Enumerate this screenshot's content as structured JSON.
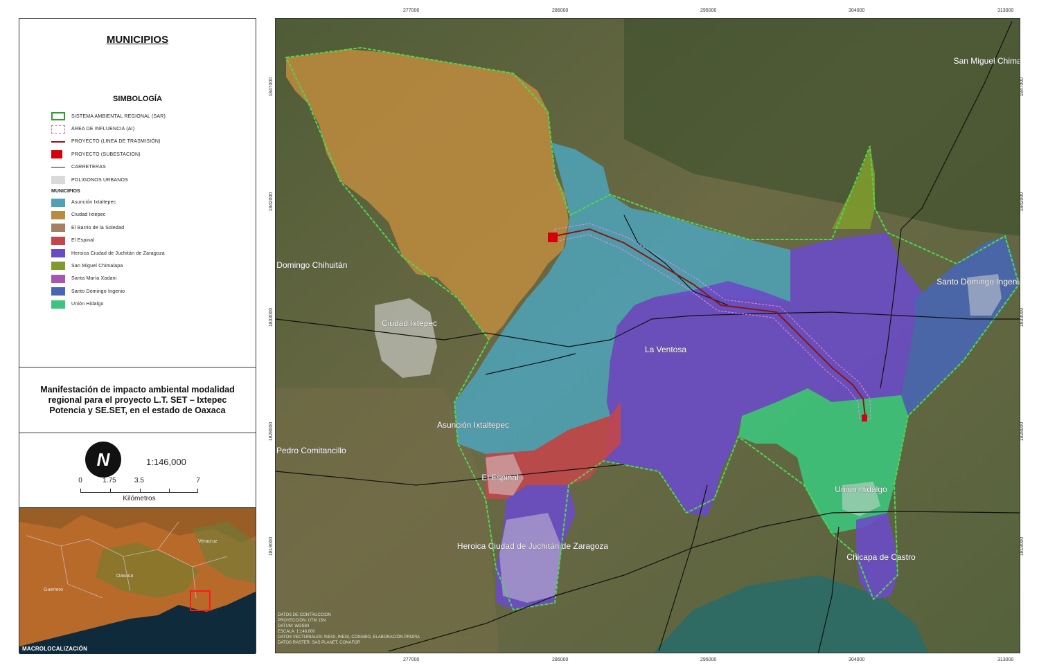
{
  "legend": {
    "municipios_title": "MUNICIPIOS",
    "simbologia_title": "SIMBOLOGÍA",
    "items": [
      {
        "label": "SISTEMA AMBIENTAL REGIONAL (SAR)",
        "color": "#2e9e2e"
      },
      {
        "label": "ÁREA DE INFLUENCIA (AI)",
        "color": "#c36ad6"
      },
      {
        "label": "PROYECTO (LINEA DE TRASMISIÓN)",
        "color": "#8b1414"
      },
      {
        "label": "PROYECTO (SUBESTACION)",
        "color": "#d6000a"
      },
      {
        "label": "CARRETERAS",
        "color": "#111111"
      },
      {
        "label": "POLIGONOS URBANOS",
        "color": "#d9d9d9"
      }
    ],
    "municipios_subtitle": "MUNICIPIOS",
    "municipios": [
      {
        "label": "Asunción Ixtaltepec",
        "color": "#4fa1b5"
      },
      {
        "label": "Ciudad Ixtepec",
        "color": "#b98a3f"
      },
      {
        "label": "El Barrio de la Soledad",
        "color": "#a58063"
      },
      {
        "label": "El Espinal",
        "color": "#c2474b"
      },
      {
        "label": "Heroica Ciudad de Juchitán de Zaragoza",
        "color": "#6a4bc6"
      },
      {
        "label": "San Miguel Chimalapa",
        "color": "#7f9a2e"
      },
      {
        "label": "Santa María Xadani",
        "color": "#a657b0"
      },
      {
        "label": "Santo Domingo Ingenio",
        "color": "#4866b3"
      },
      {
        "label": "Unión Hidalgo",
        "color": "#3dc47c"
      }
    ]
  },
  "title_block": {
    "text": "Manifestación de impacto ambiental modalidad regional para el proyecto L.T. SET – Ixtepec Potencia y SE.SET, en el estado de Oaxaca"
  },
  "scale": {
    "north": "N",
    "ratio": "1:146,000",
    "ticks": [
      "0",
      "1.75",
      "3.5",
      "7"
    ],
    "unit": "Kilómetros"
  },
  "inset": {
    "logo": "MACROLOCALIZACIÓN",
    "labels": [
      "Guerrero",
      "Oaxaca",
      "Veracruz"
    ]
  },
  "map": {
    "coords_top": [
      "277000",
      "286000",
      "295000",
      "304000",
      "313000"
    ],
    "coords_right": [
      "1847000",
      "1842000",
      "1833000",
      "1828000",
      "1819000"
    ],
    "labels": {
      "san_miguel": "San Miguel Chimalapa",
      "santo_domingo_chihuitan": "Santo Domingo Chihuitán",
      "ciudad_ixtepec": "Ciudad Ixtepec",
      "la_ventosa": "La Ventosa",
      "santo_domingo_ingenio": "Santo Domingo Ingenio",
      "asuncion": "Asunción Ixtaltepec",
      "san_pedro": "San Pedro Comitancillo",
      "el_espinal": "El Espinal",
      "union_hidalgo": "Unión Hidalgo",
      "juchitan": "Heroica Ciudad de Juchitán de Zaragoza",
      "chicapa": "Chicapa de Castro"
    },
    "credits": [
      "DATOS DE CONTRUCCION",
      "PROYECCIÓN: UTM 15N",
      "DATUM: WGS84",
      "ESCALA: 1:146,000",
      "DATOS VECTORIALES: INEGI, INEGI, CONABIO, ELABORACIÓN PROPIA",
      "DATOS RASTER: SAS PLANET, CONAFOR"
    ]
  }
}
